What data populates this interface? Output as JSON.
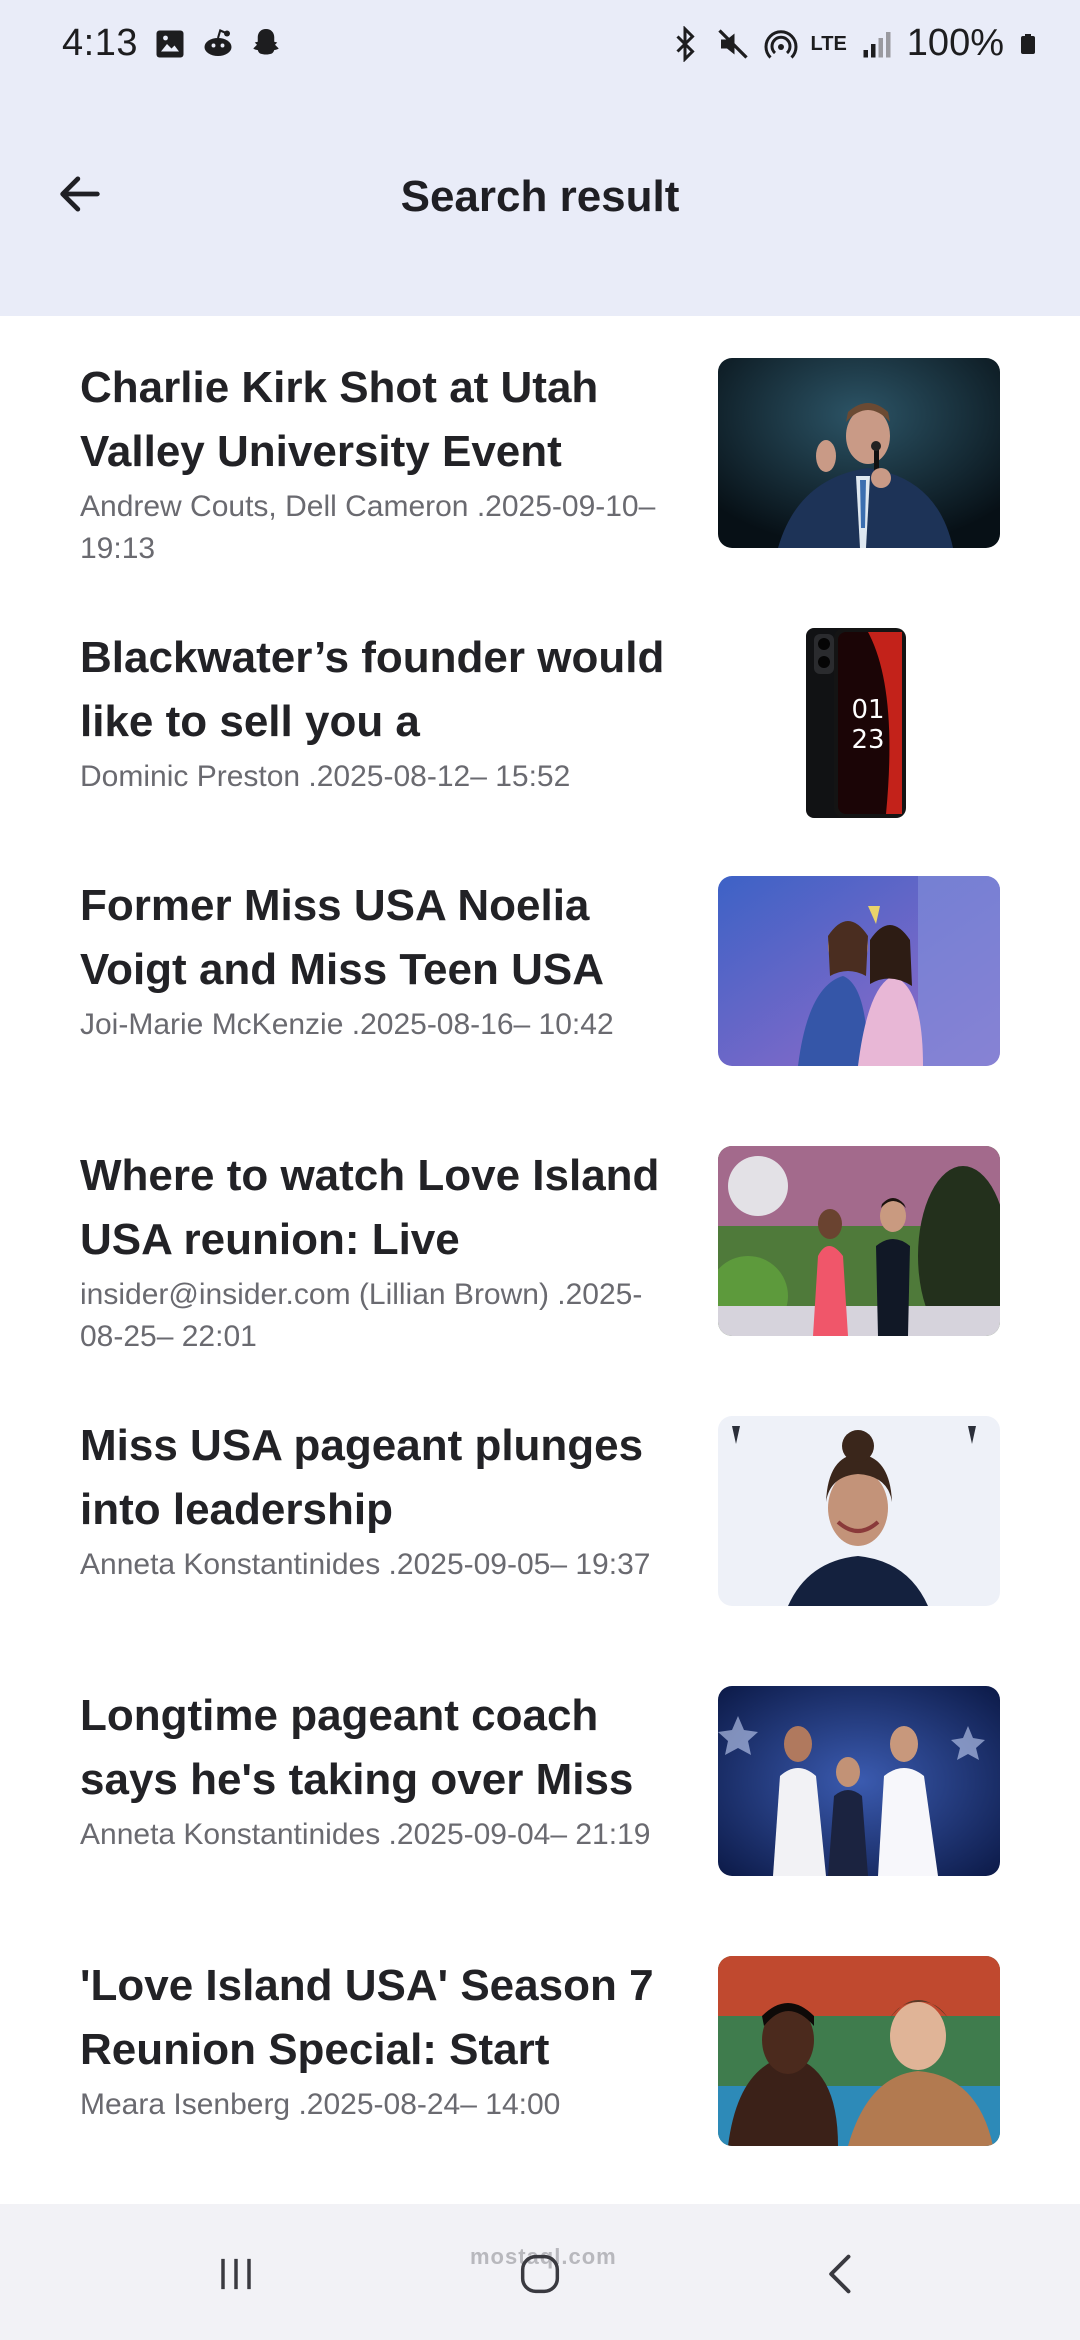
{
  "status_bar": {
    "time": "4:13",
    "battery": "100%",
    "network": "LTE",
    "left_icons": [
      "image-icon",
      "reddit-icon",
      "snapchat-icon"
    ],
    "right_icons": [
      "bluetooth-icon",
      "mute-icon",
      "hotspot-icon",
      "lte-icon",
      "signal-icon",
      "battery-icon"
    ]
  },
  "app_bar": {
    "title": "Search result",
    "back_icon": "arrow-left-icon",
    "background": "#e9ecf8"
  },
  "results": [
    {
      "title": "Charlie Kirk Shot at Utah Valley University Event",
      "meta": "Andrew Couts, Dell Cameron .2025-09-10– 19:13",
      "thumbnail": "speaker-with-microphone-photo"
    },
    {
      "title": "Blackwater’s founder would like to sell you a",
      "meta": "Dominic Preston .2025-08-12– 15:52",
      "thumbnail": "black-smartphone-photo"
    },
    {
      "title": "Former Miss USA Noelia Voigt and Miss Teen USA",
      "meta": "Joi-Marie McKenzie .2025-08-16– 10:42",
      "thumbnail": "pageant-embrace-photo"
    },
    {
      "title": "Where to watch Love Island USA reunion: Live",
      "meta": "insider@insider.com (Lillian Brown) .2025-08-25– 22:01",
      "thumbnail": "reunion-stage-couple-photo"
    },
    {
      "title": "Miss USA pageant plunges into leadership",
      "meta": "Anneta Konstantinides .2025-09-05– 19:37",
      "thumbnail": "woman-at-press-wall-photo"
    },
    {
      "title": "Longtime pageant coach says he's taking over Miss",
      "meta": "Anneta Konstantinides .2025-09-04– 21:19",
      "thumbnail": "pageant-winners-stage-photo"
    },
    {
      "title": "'Love Island USA' Season 7 Reunion Special: Start",
      "meta": "Meara Isenberg .2025-08-24– 14:00",
      "thumbnail": "couple-on-couch-photo"
    }
  ],
  "nav_bar": {
    "buttons": [
      "recent-apps-icon",
      "home-icon",
      "back-chevron-icon"
    ],
    "watermark": "mostaql.com"
  }
}
